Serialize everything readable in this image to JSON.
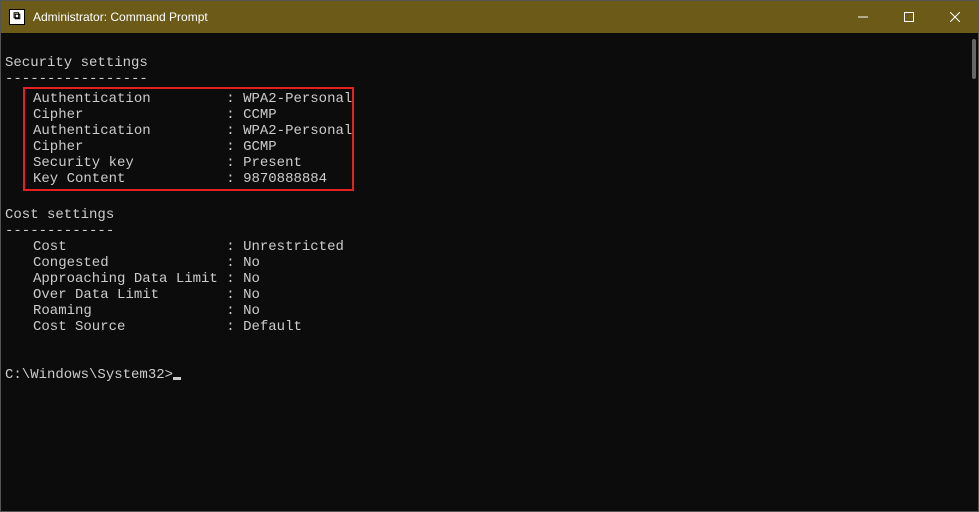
{
  "window": {
    "title": "Administrator: Command Prompt",
    "icon_label": "C:\\"
  },
  "sections": {
    "security": {
      "header": "Security settings",
      "dashes": "-----------------",
      "rows": [
        {
          "label": "Authentication",
          "value": "WPA2-Personal"
        },
        {
          "label": "Cipher",
          "value": "CCMP"
        },
        {
          "label": "Authentication",
          "value": "WPA2-Personal"
        },
        {
          "label": "Cipher",
          "value": "GCMP"
        },
        {
          "label": "Security key",
          "value": "Present"
        },
        {
          "label": "Key Content",
          "value": "9870888884"
        }
      ]
    },
    "cost": {
      "header": "Cost settings",
      "dashes": "-------------",
      "rows": [
        {
          "label": "Cost",
          "value": "Unrestricted"
        },
        {
          "label": "Congested",
          "value": "No"
        },
        {
          "label": "Approaching Data Limit",
          "value": "No"
        },
        {
          "label": "Over Data Limit",
          "value": "No"
        },
        {
          "label": "Roaming",
          "value": "No"
        },
        {
          "label": "Cost Source",
          "value": "Default"
        }
      ]
    }
  },
  "prompt": "C:\\Windows\\System32>"
}
